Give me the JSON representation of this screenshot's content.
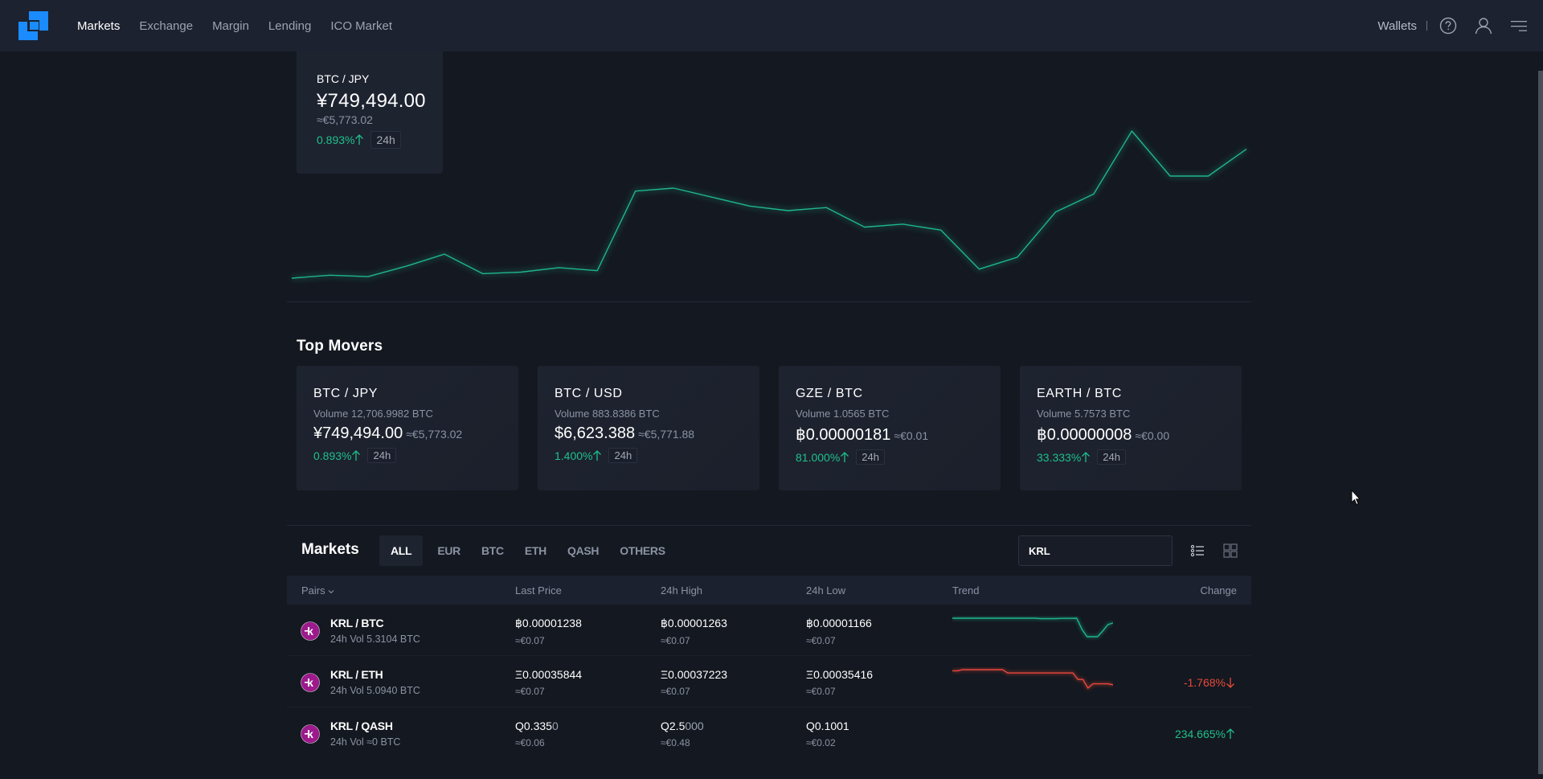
{
  "header": {
    "logo_color": "#1a8cff",
    "nav": [
      {
        "label": "Markets",
        "active": true
      },
      {
        "label": "Exchange",
        "active": false
      },
      {
        "label": "Margin",
        "active": false
      },
      {
        "label": "Lending",
        "active": false
      },
      {
        "label": "ICO Market",
        "active": false
      }
    ],
    "wallets_label": "Wallets",
    "help_icon": "question-circle-icon",
    "user_icon": "user-icon",
    "menu_icon": "hamburger-menu-icon"
  },
  "hero": {
    "pair": "BTC / JPY",
    "price": "¥749,494.00",
    "eur": "≈€5,773.02",
    "change": "0.893%",
    "direction": "up",
    "timeframe": "24h",
    "chart_color": "#1fb58d",
    "chart_series": [
      33,
      34,
      33.5,
      37,
      41,
      34.5,
      35,
      36.5,
      35.5,
      62,
      63,
      60,
      57,
      55.5,
      56.5,
      50,
      51,
      49,
      36,
      40,
      55,
      61,
      82,
      67,
      67,
      76
    ]
  },
  "top_movers": {
    "title": "Top Movers",
    "cards": [
      {
        "pair": "BTC / JPY",
        "volume": "Volume 12,706.9982 BTC",
        "price": "¥749,494.00",
        "eur": "≈€5,773.02",
        "change": "0.893%",
        "timeframe": "24h"
      },
      {
        "pair": "BTC / USD",
        "volume": "Volume 883.8386 BTC",
        "price": "$6,623.388",
        "eur": "≈€5,771.88",
        "change": "1.400%",
        "timeframe": "24h"
      },
      {
        "pair": "GZE / BTC",
        "volume": "Volume 1.0565 BTC",
        "price": "฿0.00000181",
        "eur": "≈€0.01",
        "change": "81.000%",
        "timeframe": "24h"
      },
      {
        "pair": "EARTH / BTC",
        "volume": "Volume 5.7573 BTC",
        "price": "฿0.00000008",
        "eur": "≈€0.00",
        "change": "33.333%",
        "timeframe": "24h"
      }
    ]
  },
  "markets": {
    "title": "Markets",
    "tabs": [
      {
        "label": "ALL",
        "active": true
      },
      {
        "label": "EUR",
        "active": false
      },
      {
        "label": "BTC",
        "active": false
      },
      {
        "label": "ETH",
        "active": false
      },
      {
        "label": "QASH",
        "active": false
      },
      {
        "label": "OTHERS",
        "active": false
      }
    ],
    "search_value": "KRL",
    "columns": {
      "pairs": "Pairs",
      "last_price": "Last Price",
      "high": "24h High",
      "low": "24h Low",
      "trend": "Trend",
      "change": "Change"
    },
    "rows": [
      {
        "pair": "KRL / BTC",
        "vol": "24h Vol 5.3104 BTC",
        "last": "฿0.00001238",
        "last_eur": "≈€0.07",
        "high": "฿0.00001263",
        "high_eur": "≈€0.07",
        "low": "฿0.00001166",
        "low_eur": "≈€0.07",
        "change": "",
        "direction": "none",
        "trend_color": "#1fb58d",
        "trend": [
          10,
          10,
          10,
          10,
          10,
          10,
          10,
          10,
          10,
          10,
          10,
          10,
          10,
          10,
          10,
          10,
          10,
          9.8,
          9.8,
          9.8,
          9.8,
          9.9,
          9.9,
          9.9,
          10,
          4,
          0,
          0,
          0,
          3,
          6.5,
          7.5
        ]
      },
      {
        "pair": "KRL / ETH",
        "vol": "24h Vol 5.0940 BTC",
        "last": "Ξ0.00035844",
        "last_eur": "≈€0.07",
        "high": "Ξ0.00037223",
        "high_eur": "≈€0.07",
        "low": "Ξ0.00035416",
        "low_eur": "≈€0.07",
        "change": "-1.768%",
        "direction": "down",
        "trend_color": "#e8483a",
        "trend": [
          10,
          10,
          10.5,
          10.5,
          10.5,
          10.5,
          10.5,
          10.5,
          10.5,
          10.5,
          10.5,
          9,
          9,
          9,
          9,
          9,
          9,
          9,
          9,
          9,
          9,
          9,
          9,
          9,
          9,
          6,
          6,
          2,
          4,
          4,
          4,
          4,
          3.5
        ]
      },
      {
        "pair": "KRL / QASH",
        "vol": "24h Vol ≈0 BTC",
        "last_main": "Q0.335",
        "last_dim": "0",
        "last_eur": "≈€0.06",
        "high_main": "Q2.5",
        "high_dim": "000",
        "high_eur": "≈€0.48",
        "low": "Q0.1001",
        "low_eur": "≈€0.02",
        "change": "234.665%",
        "direction": "up"
      }
    ]
  },
  "colors": {
    "up": "#1fc08a",
    "down": "#e8483a",
    "coin_krl": "#9c1a8c"
  }
}
